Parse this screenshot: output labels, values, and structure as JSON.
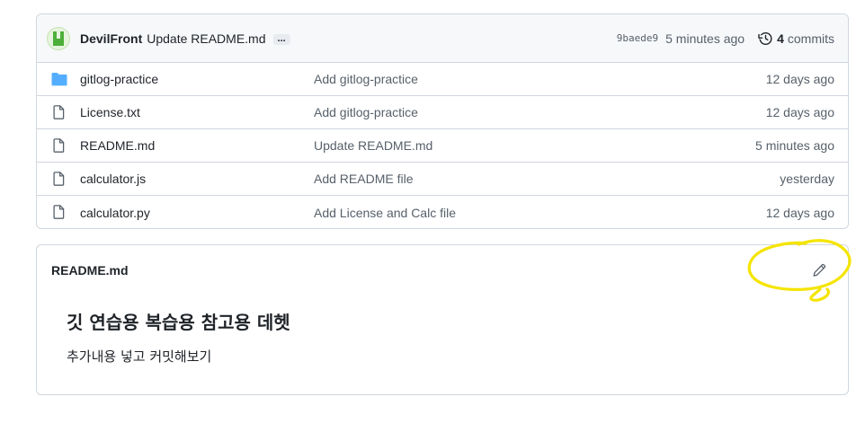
{
  "latest_commit": {
    "author": "DevilFront",
    "message": "Update README.md",
    "ellipsis": "...",
    "sha": "9baede9",
    "time": "5 minutes ago",
    "commit_count": "4",
    "commits_label": "commits"
  },
  "files": [
    {
      "type": "folder-icon",
      "name": "gitlog-practice",
      "message": "Add gitlog-practice",
      "date": "12 days ago"
    },
    {
      "type": "file-icon",
      "name": "License.txt",
      "message": "Add gitlog-practice",
      "date": "12 days ago"
    },
    {
      "type": "file-icon",
      "name": "README.md",
      "message": "Update README.md",
      "date": "5 minutes ago"
    },
    {
      "type": "file-icon",
      "name": "calculator.js",
      "message": "Add README file",
      "date": "yesterday"
    },
    {
      "type": "file-icon",
      "name": "calculator.py",
      "message": "Add License and Calc file",
      "date": "12 days ago"
    }
  ],
  "readme": {
    "filename": "README.md",
    "heading": "깃 연습용 복습용 참고용 데헷",
    "body": "추가내용 넣고 커밋해보기"
  },
  "colors": {
    "folder": "#54aeff",
    "highlight": "#f5e400",
    "border": "#d0d7de",
    "header_bg": "#f6f8fa"
  }
}
